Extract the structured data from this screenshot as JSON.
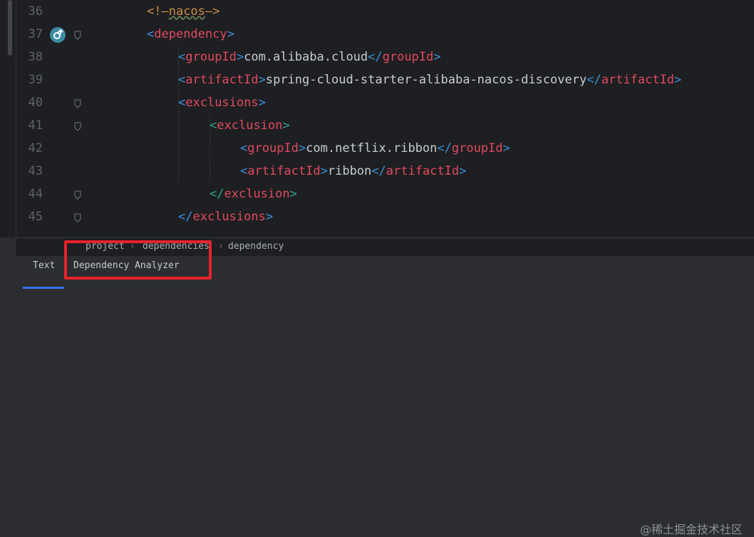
{
  "editor": {
    "lines": [
      {
        "num": "36",
        "indent": "        ",
        "open": "<!—",
        "name": "nacos",
        "close": "—>",
        "kind": "comment"
      },
      {
        "num": "37",
        "indent": "        ",
        "open": "<",
        "name": "dependency",
        "close": ">",
        "kind": "tag"
      },
      {
        "num": "38",
        "indent": "            ",
        "open": "<",
        "name": "groupId",
        "close": ">",
        "text": "com.alibaba.cloud",
        "end_open": "</",
        "end_name": "groupId",
        "end_close": ">",
        "kind": "full"
      },
      {
        "num": "39",
        "indent": "            ",
        "open": "<",
        "name": "artifactId",
        "close": ">",
        "text": "spring-cloud-starter-alibaba-nacos-discovery",
        "end_open": "</",
        "end_name": "artifactId",
        "end_close": ">",
        "kind": "full"
      },
      {
        "num": "40",
        "indent": "            ",
        "open": "<",
        "name": "exclusions",
        "close": ">",
        "kind": "tag"
      },
      {
        "num": "41",
        "indent": "                ",
        "open": "<",
        "name": "exclusion",
        "close": ">",
        "kind": "tag"
      },
      {
        "num": "42",
        "indent": "                    ",
        "open": "<",
        "name": "groupId",
        "close": ">",
        "text": "com.netflix.ribbon",
        "end_open": "</",
        "end_name": "groupId",
        "end_close": ">",
        "kind": "full"
      },
      {
        "num": "43",
        "indent": "                    ",
        "open": "<",
        "name": "artifactId",
        "close": ">",
        "text": "ribbon",
        "end_open": "</",
        "end_name": "artifactId",
        "end_close": ">",
        "kind": "full"
      },
      {
        "num": "44",
        "indent": "                ",
        "open": "</",
        "name": "exclusion",
        "close": ">",
        "kind": "tag"
      },
      {
        "num": "45",
        "indent": "            ",
        "open": "</",
        "name": "exclusions",
        "close": ">",
        "kind": "tag"
      }
    ]
  },
  "breadcrumb": {
    "items": [
      "project",
      "dependencies",
      "dependency"
    ]
  },
  "tabs": {
    "text": "Text",
    "analyzer": "Dependency Analyzer"
  },
  "watermark": "@稀土掘金技术社区",
  "colors": {
    "accent": "#3574f0",
    "highlight": "#e8232a",
    "tag": "#e04a5f",
    "bracket": "#e06c4c"
  }
}
